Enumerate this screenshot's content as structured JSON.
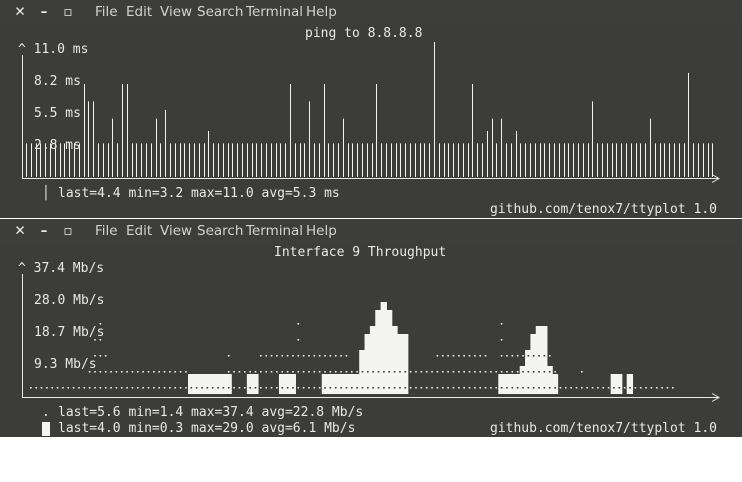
{
  "menu": [
    "File",
    "Edit",
    "View",
    "Search",
    "Terminal",
    "Help"
  ],
  "windows": [
    {
      "title": "ping to 8.8.8.8",
      "y_ticks": [
        "^ 11.0 ms",
        "8.2 ms",
        "5.5 ms",
        "2.8 ms"
      ],
      "stat_lines": [
        "last=4.4 min=3.2 max=11.0 avg=5.3 ms"
      ],
      "credit": "github.com/tenox7/ttyplot 1.0"
    },
    {
      "title": "Interface 9 Throughput",
      "y_ticks": [
        "^ 37.4 Mb/s",
        "28.0 Mb/s",
        "18.7 Mb/s",
        "9.3 Mb/s"
      ],
      "stat_lines": [
        "last=5.6 min=1.4 max=37.4 avg=22.8 Mb/s",
        "last=4.0 min=0.3 max=29.0 avg=6.1 Mb/s"
      ],
      "credit": "github.com/tenox7/ttyplot 1.0"
    }
  ],
  "chart_data": [
    {
      "type": "bar",
      "title": "ping to 8.8.8.8",
      "unit": "ms",
      "ylim": [
        0,
        11.0
      ],
      "values": [
        2.8,
        2.8,
        2.8,
        2.8,
        2.8,
        2.8,
        2.8,
        2.8,
        2.8,
        2.8,
        2.8,
        2.8,
        7.6,
        6.2,
        6.2,
        2.8,
        2.8,
        2.8,
        4.8,
        2.8,
        7.6,
        7.6,
        2.8,
        2.8,
        2.8,
        2.8,
        2.8,
        4.8,
        2.8,
        5.5,
        2.8,
        2.8,
        2.8,
        2.8,
        2.8,
        2.8,
        2.8,
        2.8,
        3.8,
        2.8,
        2.8,
        2.8,
        2.8,
        2.8,
        2.8,
        2.8,
        2.8,
        2.8,
        2.8,
        2.8,
        2.8,
        2.8,
        2.8,
        2.8,
        2.8,
        7.6,
        2.8,
        2.8,
        2.8,
        6.2,
        2.8,
        2.8,
        7.6,
        2.8,
        2.8,
        2.8,
        4.8,
        2.8,
        2.8,
        2.8,
        2.8,
        2.8,
        2.8,
        7.6,
        2.8,
        2.8,
        2.8,
        2.8,
        2.8,
        2.8,
        2.8,
        2.8,
        2.8,
        2.8,
        2.8,
        11.0,
        2.8,
        2.8,
        2.8,
        2.8,
        2.8,
        2.8,
        2.8,
        7.6,
        2.8,
        2.8,
        3.8,
        4.8,
        2.8,
        4.8,
        2.8,
        2.8,
        3.8,
        2.8,
        2.8,
        2.8,
        2.8,
        2.8,
        2.8,
        2.8,
        2.8,
        2.8,
        2.8,
        2.8,
        2.8,
        2.8,
        2.8,
        2.8,
        6.2,
        2.8,
        2.8,
        2.8,
        2.8,
        2.8,
        2.8,
        2.8,
        2.8,
        2.8,
        2.8,
        2.8,
        4.8,
        2.8,
        2.8,
        2.8,
        2.8,
        2.8,
        2.8,
        2.8,
        8.5,
        2.8,
        2.8,
        2.8,
        2.8,
        2.8
      ]
    },
    {
      "type": "area",
      "title": "Interface 9 Throughput",
      "unit": "Mb/s",
      "ylim": [
        0,
        37.4
      ],
      "series": [
        {
          "values": [
            0,
            0,
            0,
            0,
            0,
            0,
            0,
            0,
            0,
            0,
            0,
            0,
            0,
            0,
            0,
            0,
            0,
            0,
            0,
            0,
            0,
            0,
            0,
            0,
            0,
            0,
            0,
            0,
            0,
            0,
            4.7,
            4.7,
            4.7,
            4.7,
            4.7,
            4.7,
            4.7,
            4.7,
            0,
            0,
            0,
            4.7,
            4.7,
            0,
            0,
            0,
            0,
            4.7,
            4.7,
            4.7,
            0,
            0,
            0,
            0,
            0,
            4.7,
            4.7,
            4.7,
            4.7,
            4.7,
            4.7,
            4.7,
            14.0,
            18.7,
            23.4,
            28.0,
            32.7,
            28.0,
            23.4,
            18.7,
            18.7,
            0,
            0,
            0,
            0,
            0,
            0,
            0,
            0,
            0,
            0,
            0,
            0,
            0,
            0,
            0,
            0,
            0,
            4.7,
            4.7,
            4.7,
            4.7,
            9.3,
            14.0,
            18.7,
            23.4,
            23.4,
            9.3,
            4.7,
            0,
            0,
            0,
            0,
            0,
            0,
            0,
            0,
            0,
            0,
            4.7,
            4.7,
            0,
            4.7,
            0,
            0
          ]
        },
        {
          "values": [
            4.7,
            4.7,
            4.7,
            4.7,
            4.7,
            4.7,
            4.7,
            4.7,
            4.7,
            4.7,
            4.7,
            9.3,
            23.4,
            28.0,
            18.7,
            9.3,
            9.3,
            9.3,
            9.3,
            9.3,
            9.3,
            9.3,
            9.3,
            9.3,
            9.3,
            9.3,
            9.3,
            9.3,
            9.3,
            9.3,
            4.7,
            4.7,
            4.7,
            4.7,
            4.7,
            4.7,
            4.7,
            18.7,
            9.3,
            9.3,
            9.3,
            9.3,
            9.3,
            18.7,
            18.7,
            18.7,
            18.7,
            18.7,
            18.7,
            18.7,
            28.0,
            18.7,
            18.7,
            18.7,
            18.7,
            18.7,
            18.7,
            18.7,
            18.7,
            18.7,
            9.3,
            9.3,
            9.3,
            9.3,
            9.3,
            9.3,
            9.3,
            9.3,
            9.3,
            9.3,
            9.3,
            9.3,
            9.3,
            9.3,
            9.3,
            9.3,
            18.7,
            18.7,
            18.7,
            18.7,
            18.7,
            18.7,
            18.7,
            18.7,
            18.7,
            18.7,
            9.3,
            9.3,
            28.0,
            18.7,
            18.7,
            18.7,
            18.7,
            18.7,
            18.7,
            18.7,
            18.7,
            18.7,
            9.3,
            4.7,
            4.7,
            4.7,
            4.7,
            9.3,
            4.7,
            4.7,
            4.7,
            4.7,
            4.7,
            4.7,
            4.7,
            4.7,
            4.7,
            4.7,
            4.7,
            4.7,
            4.7,
            4.7,
            4.7,
            4.7,
            4.7
          ]
        }
      ]
    }
  ]
}
